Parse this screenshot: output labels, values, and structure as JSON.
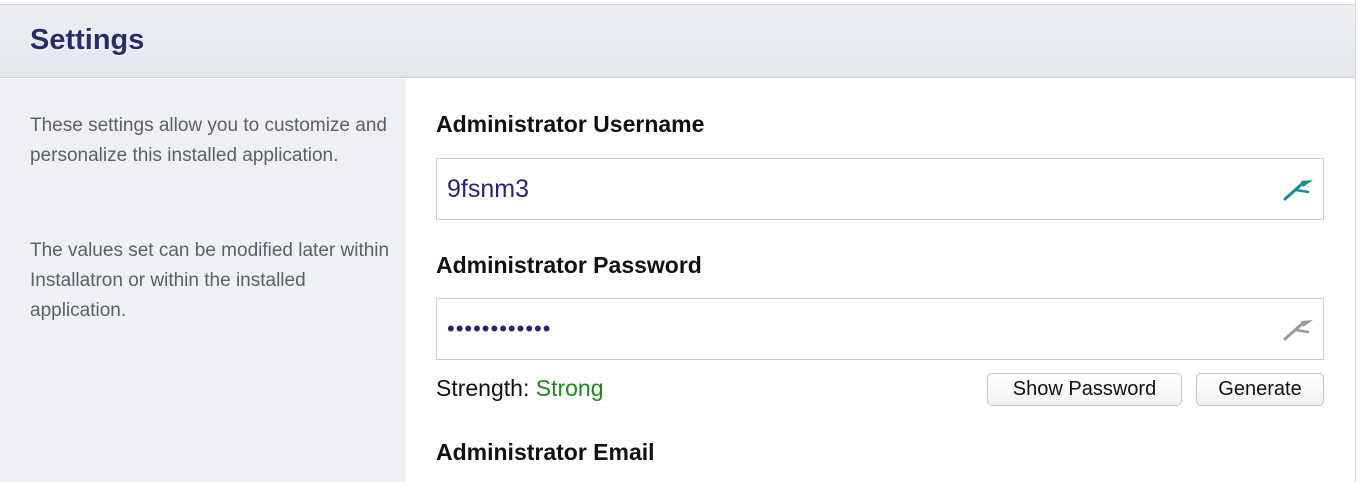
{
  "header": {
    "title": "Settings"
  },
  "sidebar": {
    "paragraph1": "These settings allow you to customize and personalize this installed application.",
    "paragraph2": "The values set can be modified later within Installatron or within the installed application."
  },
  "form": {
    "username": {
      "label": "Administrator Username",
      "value": "9fsnm3",
      "icon": "magic-wand-icon"
    },
    "password": {
      "label": "Administrator Password",
      "value": "••••••••••••",
      "icon": "magic-wand-icon"
    },
    "strength": {
      "label": "Strength:",
      "value": "Strong"
    },
    "buttons": {
      "show_password": "Show Password",
      "generate": "Generate"
    },
    "email": {
      "label": "Administrator Email"
    }
  },
  "colors": {
    "title": "#2a2a6e",
    "input_text": "#27237a",
    "strength_strong": "#1e8a1e",
    "wand_active": "#1a8a9a",
    "wand_inactive": "#9a9a9a"
  }
}
